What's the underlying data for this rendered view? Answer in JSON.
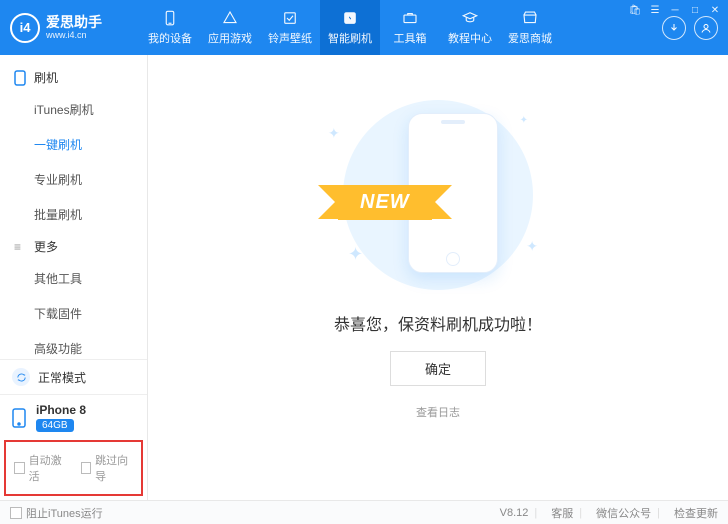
{
  "header": {
    "logo_label": "i4",
    "app_name": "爱思助手",
    "app_url": "www.i4.cn",
    "nav": [
      {
        "label": "我的设备"
      },
      {
        "label": "应用游戏"
      },
      {
        "label": "铃声壁纸"
      },
      {
        "label": "智能刷机"
      },
      {
        "label": "工具箱"
      },
      {
        "label": "教程中心"
      },
      {
        "label": "爱思商城"
      }
    ]
  },
  "sidebar": {
    "section1": "刷机",
    "items1": [
      {
        "label": "iTunes刷机"
      },
      {
        "label": "一键刷机"
      },
      {
        "label": "专业刷机"
      },
      {
        "label": "批量刷机"
      }
    ],
    "section2": "更多",
    "items2": [
      {
        "label": "其他工具"
      },
      {
        "label": "下载固件"
      },
      {
        "label": "高级功能"
      }
    ],
    "mode": "正常模式",
    "device": "iPhone 8",
    "storage": "64GB",
    "auto_activate": "自动激活",
    "skip_guide": "跳过向导"
  },
  "main": {
    "ribbon": "NEW",
    "success": "恭喜您，保资料刷机成功啦！",
    "confirm": "确定",
    "view_log": "查看日志"
  },
  "footer": {
    "block_itunes": "阻止iTunes运行",
    "version": "V8.12",
    "support": "客服",
    "wechat": "微信公众号",
    "check_update": "检查更新"
  }
}
